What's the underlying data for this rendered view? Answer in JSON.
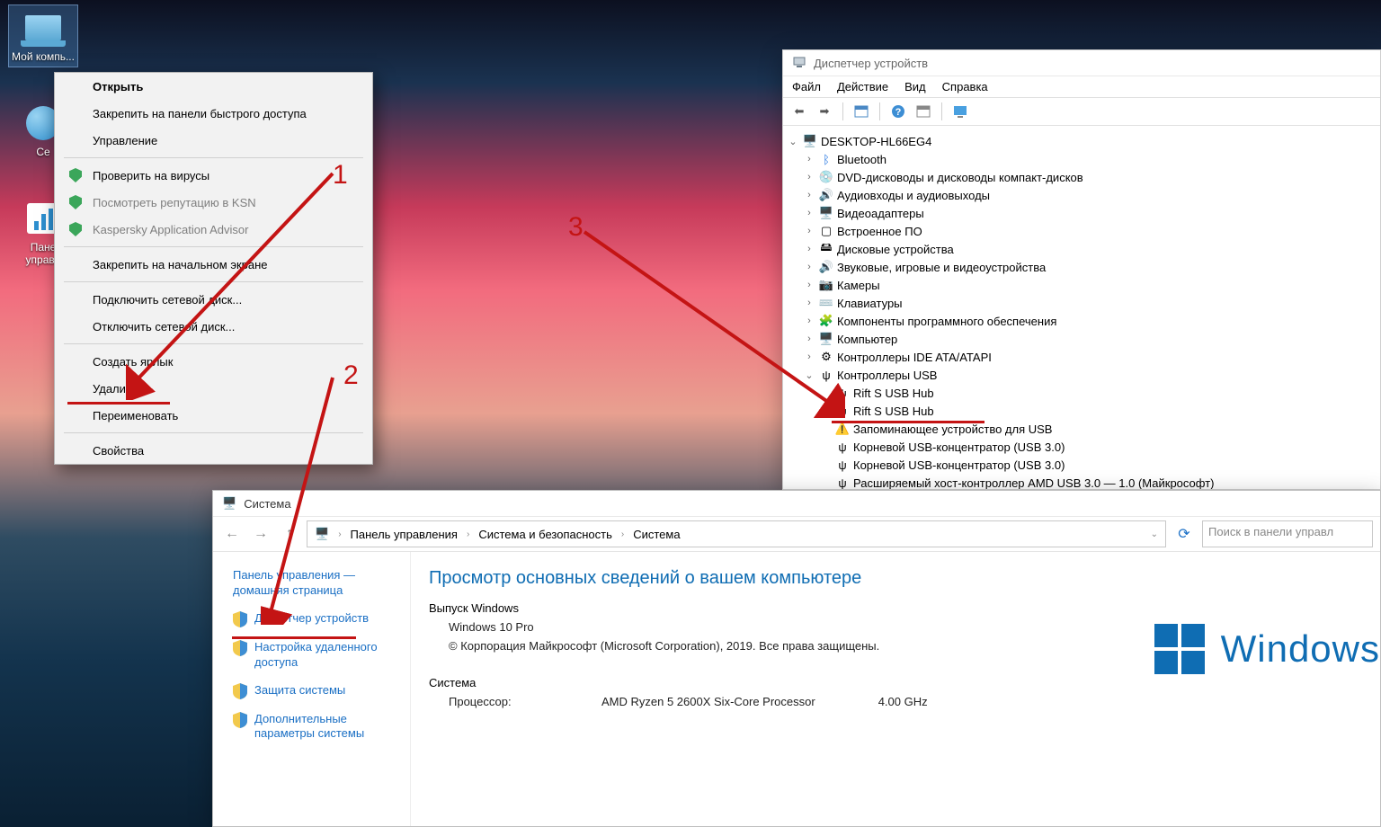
{
  "desktop_icons": {
    "my_computer": "Мой компь...",
    "network": "Се",
    "panel": "Пане\nуправл"
  },
  "context_menu": {
    "open": "Открыть",
    "pin_quick": "Закрепить на панели быстрого доступа",
    "manage": "Управление",
    "scan": "Проверить на вирусы",
    "ksn": "Посмотреть репутацию в KSN",
    "advisor": "Kaspersky Application Advisor",
    "pin_start": "Закрепить на начальном экране",
    "map_drive": "Подключить сетевой диск...",
    "unmap_drive": "Отключить сетевой диск...",
    "shortcut": "Создать ярлык",
    "delete": "Удалить",
    "rename": "Переименовать",
    "properties": "Свойства"
  },
  "dm": {
    "title": "Диспетчер устройств",
    "menu": {
      "file": "Файл",
      "action": "Действие",
      "view": "Вид",
      "help": "Справка"
    },
    "root": "DESKTOP-HL66EG4",
    "cats": {
      "bluetooth": "Bluetooth",
      "dvd": "DVD-дисководы и дисководы компакт-дисков",
      "audio_io": "Аудиовходы и аудиовыходы",
      "video": "Видеоадаптеры",
      "firmware": "Встроенное ПО",
      "disk": "Дисковые устройства",
      "sound": "Звуковые, игровые и видеоустройства",
      "camera": "Камеры",
      "keyboard": "Клавиатуры",
      "softcomp": "Компоненты программного обеспечения",
      "computer": "Компьютер",
      "ide": "Контроллеры IDE ATA/ATAPI",
      "usb": "Контроллеры USB"
    },
    "usb_children": {
      "rift1": "Rift S USB Hub",
      "rift2": "Rift S USB Hub",
      "storage": "Запоминающее устройство для USB",
      "root1": "Корневой USB-концентратор (USB 3.0)",
      "root2": "Корневой USB-концентратор (USB 3.0)",
      "amd": "Расширяемый хост-контроллер AMD USB 3.0 — 1.0 (Майкрософт)"
    }
  },
  "sys": {
    "title": "Система",
    "crumbs": {
      "cp": "Панель управления",
      "sec": "Система и безопасность",
      "sys": "Система"
    },
    "search_ph": "Поиск в панели управл",
    "side": {
      "home": "Панель управления — домашняя страница",
      "devmgr": "Диспетчер устройств",
      "remote": "Настройка удаленного доступа",
      "protect": "Защита системы",
      "advanced": "Дополнительные параметры системы"
    },
    "heading": "Просмотр основных сведений о вашем компьютере",
    "edition_label": "Выпуск Windows",
    "edition_value": "Windows 10 Pro",
    "copyright": "© Корпорация Майкрософт (Microsoft Corporation), 2019. Все права защищены.",
    "system_label": "Система",
    "cpu_label": "Процессор:",
    "cpu_value": "AMD Ryzen 5 2600X Six-Core Processor",
    "cpu_freq": "4.00 GHz",
    "win_brand": "Windows"
  },
  "annot": {
    "n1": "1",
    "n2": "2",
    "n3": "3"
  }
}
